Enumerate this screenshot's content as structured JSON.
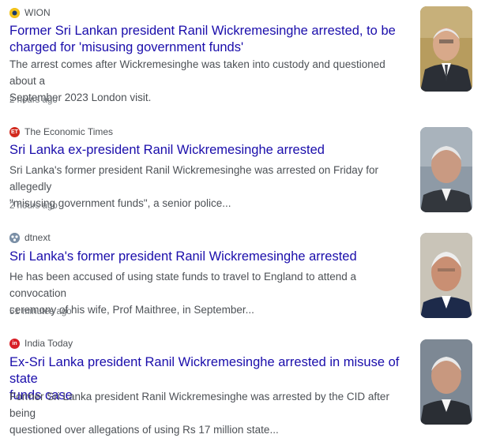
{
  "articles": [
    {
      "source": "WION",
      "icon": "wion-logo-icon",
      "icon_color": "#f2c21b",
      "title_line1": "Former Sri Lankan president Ranil Wickremesinghe arrested, to be",
      "title_line2": "charged for 'misusing government funds'",
      "snippet_line1": "The arrest comes after Wickremesinghe was taken into custody and questioned about a",
      "snippet_line2": "September 2023 London visit.",
      "time": "2 hours ago"
    },
    {
      "source": "The Economic Times",
      "icon": "economic-times-logo-icon",
      "icon_color": "#d22a1e",
      "icon_text": "ET",
      "title_line1": "Sri Lanka ex-president Ranil Wickremesinghe arrested",
      "snippet_line1": "Sri Lanka's former president Ranil Wickremesinghe was arrested on Friday for allegedly",
      "snippet_line2": "\"misusing government funds\", a senior police...",
      "time": "2 hours ago"
    },
    {
      "source": "dtnext",
      "icon": "dtnext-logo-icon",
      "icon_color": "#7a8fa6",
      "title_line1": "Sri Lanka's former president Ranil Wickremesinghe arrested",
      "snippet_line1": "He has been accused of using state funds to travel to England to attend a convocation",
      "snippet_line2": "ceremony of his wife, Prof Maithree, in September...",
      "time": "51 minutes ago"
    },
    {
      "source": "India Today",
      "icon": "india-today-logo-icon",
      "icon_color": "#d81f26",
      "icon_text": "in",
      "title_line1": "Ex-Sri Lanka president Ranil Wickremesinghe arrested in misuse of state",
      "title_line2": "funds case",
      "snippet_line1": "Former Sri Lanka president Ranil Wickremesinghe was arrested by the CID after being",
      "snippet_line2": "questioned over allegations of using Rs 17 million state..."
    }
  ]
}
